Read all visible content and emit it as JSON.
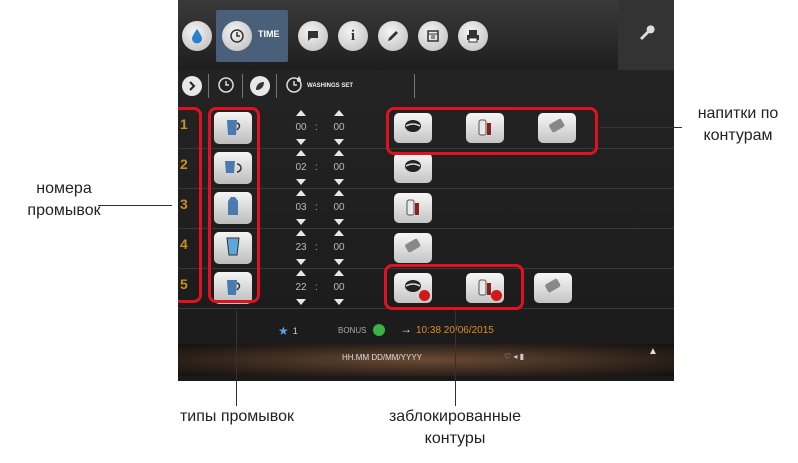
{
  "topbar": {
    "time_tab_label": "TIME",
    "icons": [
      "drop-icon",
      "clock-icon",
      "flag-icon",
      "info-icon",
      "pencil-icon",
      "calendar-icon",
      "printer-icon",
      "wrench-icon"
    ]
  },
  "subbar": {
    "washings_label": "WASHINGS SET"
  },
  "rows": [
    {
      "num": "1",
      "hh": "00",
      "sep": ":",
      "mm": "00"
    },
    {
      "num": "2",
      "hh": "02",
      "sep": ":",
      "mm": "00"
    },
    {
      "num": "3",
      "hh": "03",
      "sep": ":",
      "mm": "00"
    },
    {
      "num": "4",
      "hh": "23",
      "sep": ":",
      "mm": "00"
    },
    {
      "num": "5",
      "hh": "22",
      "sep": ":",
      "mm": "00"
    }
  ],
  "status": {
    "count": "1",
    "bonus": "BONUS",
    "datetime": "10:38 20/06/2015",
    "format_hint": "HH.MM DD/MM/YYYY"
  },
  "annotations": {
    "wash_numbers_1": "номера",
    "wash_numbers_2": "промывок",
    "drinks_1": "напитки по",
    "drinks_2": "контурам",
    "wash_types": "типы промывок",
    "blocked_1": "заблокированные",
    "blocked_2": "контуры"
  },
  "colors": {
    "accent": "#e0121f",
    "number": "#c8901a",
    "tab_active": "#4a5f7a"
  }
}
